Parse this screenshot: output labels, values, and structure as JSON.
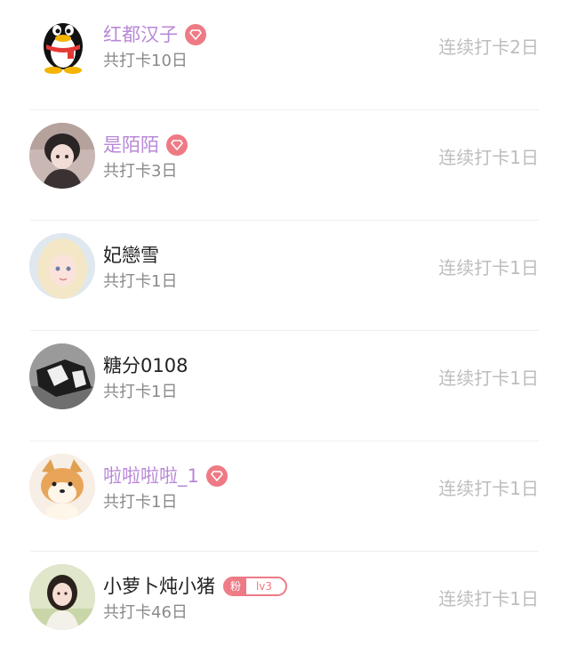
{
  "colors": {
    "vip_name": "#b888d8",
    "normal_name": "#222222",
    "badge": "#ee7a85",
    "secondary_text": "#8a8a8a",
    "streak_text": "#bdbdbd"
  },
  "users": [
    {
      "name": "红都汉子",
      "vip": true,
      "badge": "gem",
      "total": "共打卡10日",
      "streak": "连续打卡2日",
      "avatar_icon": "qq-penguin-icon"
    },
    {
      "name": "是陌陌",
      "vip": true,
      "badge": "gem",
      "total": "共打卡3日",
      "streak": "连续打卡1日",
      "avatar_icon": "avatar-photo"
    },
    {
      "name": "妃戀雪",
      "vip": false,
      "badge": "",
      "total": "共打卡1日",
      "streak": "连续打卡1日",
      "avatar_icon": "avatar-photo"
    },
    {
      "name": "糖分0108",
      "vip": false,
      "badge": "",
      "total": "共打卡1日",
      "streak": "连续打卡1日",
      "avatar_icon": "avatar-photo"
    },
    {
      "name": "啦啦啦啦_1",
      "vip": true,
      "badge": "gem",
      "total": "共打卡1日",
      "streak": "连续打卡1日",
      "avatar_icon": "avatar-photo"
    },
    {
      "name": "小萝卜炖小猪",
      "vip": false,
      "badge": "fan",
      "fan_label": "粉",
      "fan_level": "lv3",
      "total": "共打卡46日",
      "streak": "连续打卡1日",
      "avatar_icon": "avatar-photo"
    }
  ]
}
